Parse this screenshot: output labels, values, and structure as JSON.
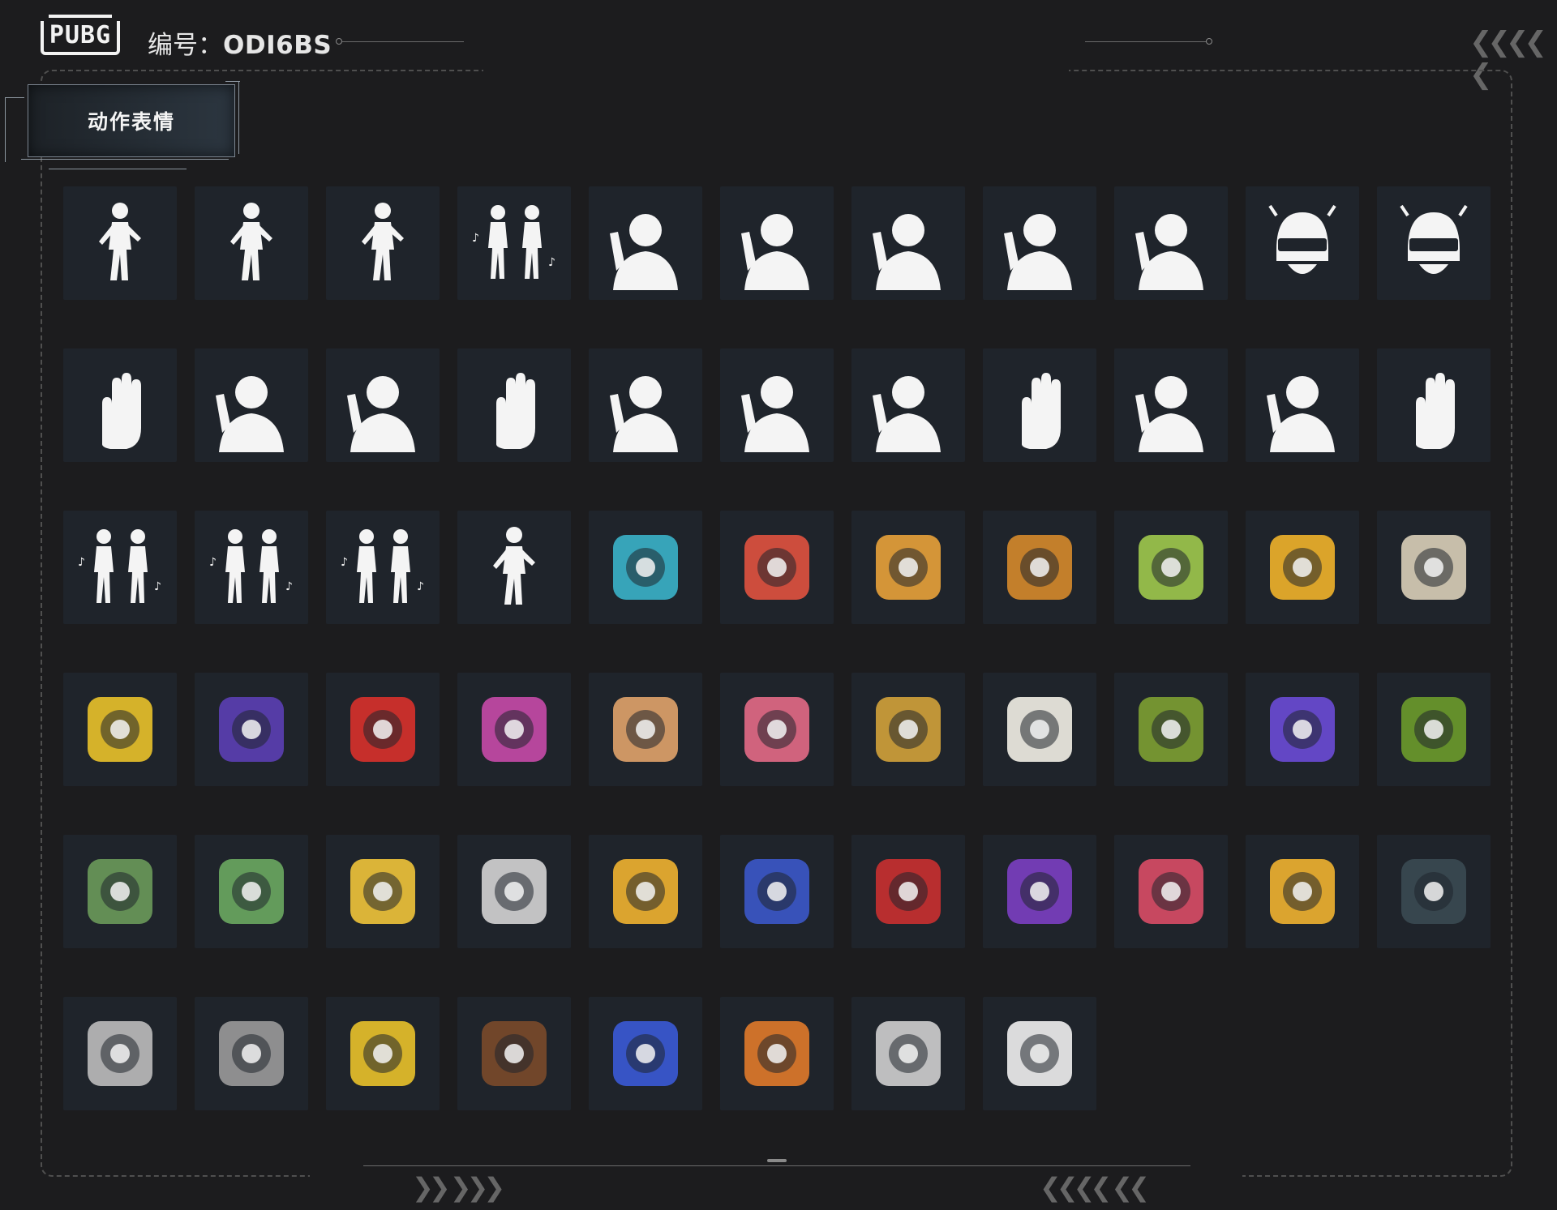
{
  "header": {
    "logo_text": "PUBG",
    "id_label": "编号：",
    "id_value": "ODI6BS"
  },
  "section": {
    "tab_label": "动作表情"
  },
  "colors": {
    "background": "#1c1c1e",
    "tile": "#1f242b",
    "frame": "#4f4f4f"
  },
  "emotes": [
    {
      "icon": "pose-karate-figure-icon",
      "kind": "fig"
    },
    {
      "icon": "dance-girl-figure-icon",
      "kind": "fig"
    },
    {
      "icon": "crouch-figure-icon",
      "kind": "fig"
    },
    {
      "icon": "two-figures-dance-icon",
      "kind": "fig2"
    },
    {
      "icon": "heart-hand-icon",
      "kind": "bust"
    },
    {
      "icon": "hands-up-icon",
      "kind": "bust"
    },
    {
      "icon": "wave-hand-icon",
      "kind": "bust"
    },
    {
      "icon": "head-turn-icon",
      "kind": "bust"
    },
    {
      "icon": "lean-arm-icon",
      "kind": "bust"
    },
    {
      "icon": "angry-helmet-icon",
      "kind": "helmet"
    },
    {
      "icon": "laughing-helmet-icon",
      "kind": "helmet"
    },
    {
      "icon": "clap-hands-icon",
      "kind": "hand"
    },
    {
      "icon": "face-palm-icon",
      "kind": "bust"
    },
    {
      "icon": "spin-head-icon",
      "kind": "bust"
    },
    {
      "icon": "point-finger-icon",
      "kind": "hand"
    },
    {
      "icon": "thumb-gesture-icon",
      "kind": "bust"
    },
    {
      "icon": "shrug-icon",
      "kind": "bust"
    },
    {
      "icon": "arms-crossed-icon",
      "kind": "bust"
    },
    {
      "icon": "flex-arm-icon",
      "kind": "hand"
    },
    {
      "icon": "cover-face-icon",
      "kind": "bust"
    },
    {
      "icon": "facepalm-sad-icon",
      "kind": "bust"
    },
    {
      "icon": "stop-hand-icon",
      "kind": "hand"
    },
    {
      "icon": "dance-duo-music-icon",
      "kind": "fig2"
    },
    {
      "icon": "dance-clap-music-icon",
      "kind": "fig2"
    },
    {
      "icon": "dance-point-music-icon",
      "kind": "fig2"
    },
    {
      "icon": "breakdance-music-icon",
      "kind": "fig"
    },
    {
      "icon": "speaker-box-icon",
      "kind": "sticker",
      "color": "#3ab3c9"
    },
    {
      "icon": "flower-heart-icon",
      "kind": "sticker",
      "color": "#e0523f"
    },
    {
      "icon": "pizza-slice-icon",
      "kind": "sticker",
      "color": "#e8a23a"
    },
    {
      "icon": "mischief-paws-icon",
      "kind": "sticker",
      "color": "#d58a2b"
    },
    {
      "icon": "potion-bottle-icon",
      "kind": "sticker",
      "color": "#9ec94c"
    },
    {
      "icon": "pgs-grenade-badge-icon",
      "kind": "sticker",
      "color": "#f0b22a"
    },
    {
      "icon": "pgs-tower-card-icon",
      "kind": "sticker",
      "color": "#d9cfb8"
    },
    {
      "icon": "global-series-globe-icon",
      "kind": "sticker",
      "color": "#e9c22a"
    },
    {
      "icon": "letter-blocks-icon",
      "kind": "sticker",
      "color": "#5b3fb4"
    },
    {
      "icon": "red-diamond-badge-icon",
      "kind": "sticker",
      "color": "#d8312b"
    },
    {
      "icon": "gas-mask-icon",
      "kind": "sticker",
      "color": "#c64aa8"
    },
    {
      "icon": "number-five-icon",
      "kind": "sticker",
      "color": "#e0a36a"
    },
    {
      "icon": "anime-girls-icon",
      "kind": "sticker",
      "color": "#e36a86"
    },
    {
      "icon": "crowned-eight-icon",
      "kind": "sticker",
      "color": "#d2a23a"
    },
    {
      "icon": "fried-egg-icon",
      "kind": "sticker",
      "color": "#f2efe6"
    },
    {
      "icon": "grenade-icon",
      "kind": "sticker",
      "color": "#7da032"
    },
    {
      "icon": "twitch-rivals-icon",
      "kind": "sticker",
      "color": "#6a4bd6"
    },
    {
      "icon": "ghillie-suit-icon",
      "kind": "sticker",
      "color": "#6c9b2b"
    },
    {
      "icon": "grumpy-blob-icon",
      "kind": "sticker",
      "color": "#6a9a5a"
    },
    {
      "icon": "knight-frog-icon",
      "kind": "sticker",
      "color": "#6aa860"
    },
    {
      "icon": "rooster-icon",
      "kind": "sticker",
      "color": "#f0c43a"
    },
    {
      "icon": "lucky-cards-icon",
      "kind": "sticker",
      "color": "#d4d4d4"
    },
    {
      "icon": "chick-sunglasses-icon",
      "kind": "sticker",
      "color": "#f0b230"
    },
    {
      "icon": "graffiti-tic-tac-icon",
      "kind": "sticker",
      "color": "#3b58c9"
    },
    {
      "icon": "hooded-masked-icon",
      "kind": "sticker",
      "color": "#c93030"
    },
    {
      "icon": "twitch-rivals-purple-icon",
      "kind": "sticker",
      "color": "#7b3fc2"
    },
    {
      "icon": "cry-baby-heart-icon",
      "kind": "sticker",
      "color": "#d94c66"
    },
    {
      "icon": "chick-bow-icon",
      "kind": "sticker",
      "color": "#f0b230"
    },
    {
      "icon": "dark-creature-icon",
      "kind": "sticker",
      "color": "#3a4a52"
    },
    {
      "icon": "death-card-icon",
      "kind": "sticker",
      "color": "#bdbdbd"
    },
    {
      "icon": "smoking-cat-icon",
      "kind": "sticker",
      "color": "#9a9a9a"
    },
    {
      "icon": "peace-sign-icon",
      "kind": "sticker",
      "color": "#e9c22a"
    },
    {
      "icon": "glove-hand-icon",
      "kind": "sticker",
      "color": "#7a4a2a"
    },
    {
      "icon": "lighter-fire-icon",
      "kind": "sticker",
      "color": "#3a5ad6"
    },
    {
      "icon": "camper-territory-icon",
      "kind": "sticker",
      "color": "#e07a2a"
    },
    {
      "icon": "rifle-click-icon",
      "kind": "sticker",
      "color": "#cfcfcf"
    },
    {
      "icon": "ghost-sunglasses-icon",
      "kind": "sticker",
      "color": "#efefef"
    }
  ]
}
